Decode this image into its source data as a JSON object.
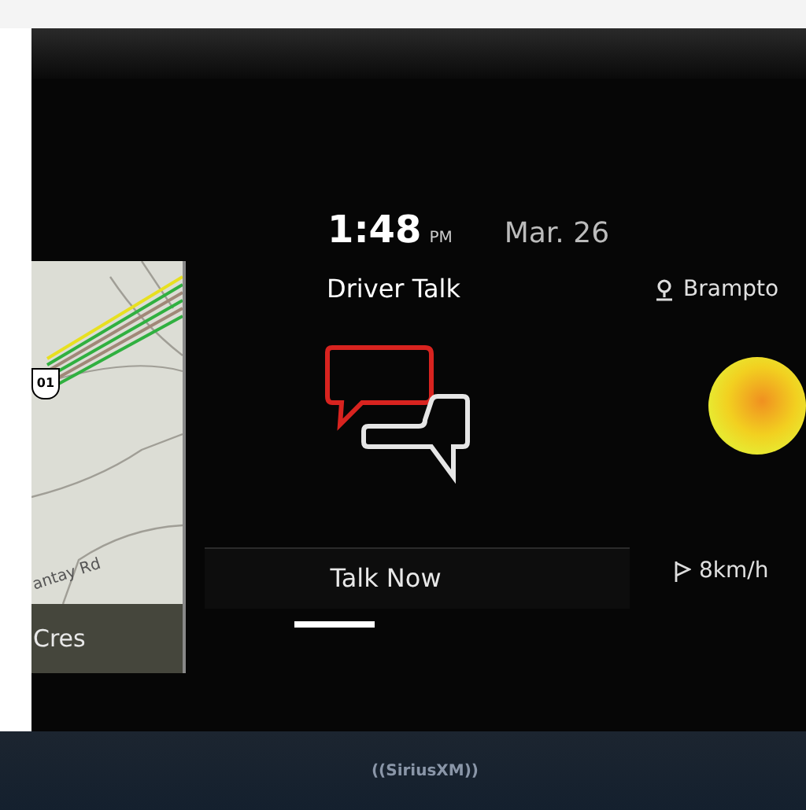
{
  "clock": {
    "time": "1:48",
    "meridiem": "PM",
    "date": "Mar. 26"
  },
  "map": {
    "route_shield": "01",
    "road_label": "antay Rd",
    "street_bar": "Cres"
  },
  "widget": {
    "title": "Driver Talk",
    "action": "Talk Now"
  },
  "pages": [
    {
      "selected": true
    }
  ],
  "weather": {
    "location": "Brampto",
    "wind": "8km/h"
  },
  "brand": "((SiriusXM))"
}
